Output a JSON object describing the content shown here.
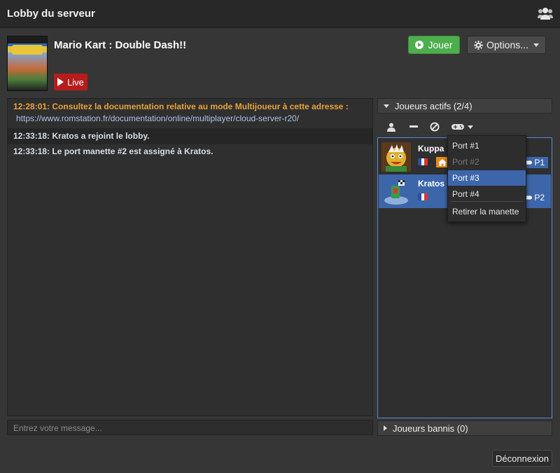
{
  "window": {
    "title": "Lobby du serveur",
    "icon": "users-icon"
  },
  "game": {
    "title": "Mario Kart : Double Dash!!",
    "live_label": "Live",
    "play_label": "Jouer",
    "options_label": "Options..."
  },
  "chat": {
    "messages": [
      {
        "time": "12:28:01:",
        "text": "Consultez la documentation relative au mode Multijoueur à cette adresse :",
        "link": "https://www.romstation.fr/documentation/online/multiplayer/cloud-server-r20/",
        "color": "#e8a23a"
      },
      {
        "time": "12:33:18:",
        "text": "Kratos a rejoint le lobby."
      },
      {
        "time": "12:33:18:",
        "text": "Le port manette #2 est assigné à Kratos."
      }
    ],
    "input_placeholder": "Entrez votre message..."
  },
  "players_panel": {
    "header": "Joueurs actifs (2/4)",
    "players": [
      {
        "name": "Kuppa",
        "port": "P1",
        "host": true,
        "selected": false
      },
      {
        "name": "Kratos",
        "port": "P2",
        "host": false,
        "selected": true
      }
    ]
  },
  "port_menu": {
    "items": [
      {
        "label": "Port #1",
        "state": "normal"
      },
      {
        "label": "Port #2",
        "state": "disabled"
      },
      {
        "label": "Port #3",
        "state": "active"
      },
      {
        "label": "Port #4",
        "state": "normal"
      }
    ],
    "remove_label": "Retirer la manette"
  },
  "banned_panel": {
    "header": "Joueurs bannis (0)"
  },
  "footer": {
    "disconnect_label": "Déconnexion"
  },
  "colors": {
    "accent": "#3d66aa",
    "play": "#4cae4c",
    "live": "#b71c1c",
    "system_msg": "#e8a23a",
    "host": "#e88a1a"
  }
}
